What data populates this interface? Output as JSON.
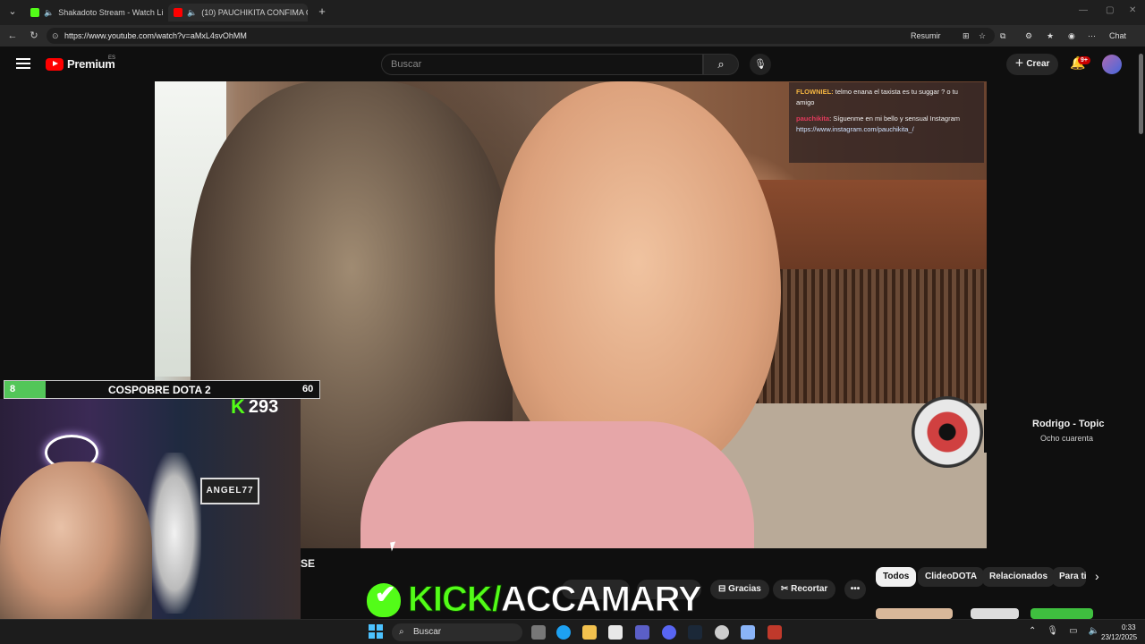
{
  "browser": {
    "tabs": [
      {
        "title": "Shakadoto Stream - Watch Li",
        "favicon_color": "#53fc18",
        "active": false
      },
      {
        "title": "(10) PAUCHIKITA CONFIMA C",
        "favicon_color": "#ff0000",
        "active": true
      }
    ],
    "url": "https://www.youtube.com/watch?v=aMxL4svOhMM",
    "toolbar": {
      "summarize_label": "Resumir",
      "chat_label": "Chat"
    }
  },
  "youtube": {
    "logo_text": "Premium",
    "region": "ES",
    "search_placeholder": "Buscar",
    "create_label": "Crear",
    "notification_count": "9+"
  },
  "video_overlay_chat": {
    "line1_user": "FLOWNIEL:",
    "line1_text": " telmo enana el taxista es tu suggar ? o tu amigo",
    "line2_user": "pauchikita",
    "line2_text": ": Síguenme en mi bello y sensual Instagram",
    "line2_link": "https://www.instagram.com/pauchikita_/"
  },
  "stream_overlay": {
    "goal_left": "8",
    "goal_title": "COSPOBRE DOTA 2",
    "goal_right": "60",
    "goal_progress": 0.13,
    "kick_viewers": "293",
    "webcam_sign": "ANGEL77"
  },
  "below_video": {
    "title_fragment": "SE",
    "kick_banner_left": "KICK/",
    "kick_banner_right": "ACCAMARY",
    "actions": [
      {
        "label": "Gracias",
        "icon": "thanks-icon"
      },
      {
        "label": "Recortar",
        "icon": "scissors-icon"
      },
      {
        "label": "•••",
        "icon": "more-icon"
      }
    ]
  },
  "related_chips": [
    {
      "label": "Todos",
      "active": true
    },
    {
      "label": "ClideoDOTA",
      "active": false
    },
    {
      "label": "Relacionados",
      "active": false
    },
    {
      "label": "Para ti",
      "active": false
    }
  ],
  "music": {
    "title": "Rodrigo - Topic",
    "subtitle": "Ocho cuarenta"
  },
  "taskbar": {
    "search_label": "Buscar",
    "time": "0:33",
    "date": "23/12/2025"
  }
}
